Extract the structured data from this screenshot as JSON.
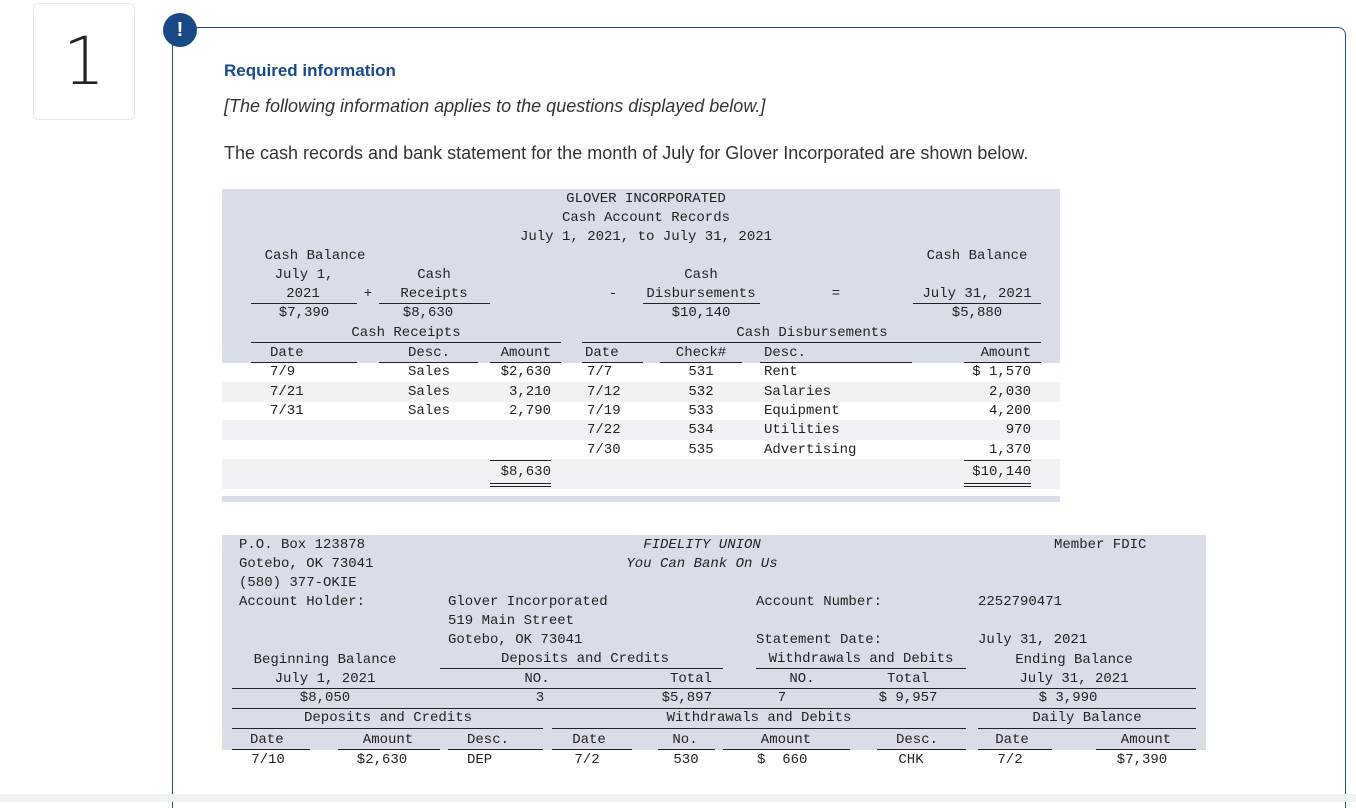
{
  "question": {
    "number": "1",
    "alert_icon": "!",
    "required": "Required information",
    "note": "[The following information applies to the questions displayed below.]",
    "intro": "The cash records and bank statement for the month of July for Glover Incorporated are shown below."
  },
  "cash_records": {
    "title": [
      "GLOVER INCORPORATED",
      "Cash Account Records",
      "July 1, 2021, to July 31, 2021"
    ],
    "summary": {
      "begin_label": [
        "Cash Balance",
        "July 1,",
        "2021"
      ],
      "begin_value": "$7,390",
      "plus": "+",
      "receipts_label": [
        "Cash",
        "Receipts"
      ],
      "receipts_value": "$8,630",
      "minus": "-",
      "disb_label": [
        "Cash",
        "Disbursements"
      ],
      "disb_value": "$10,140",
      "equals": "=",
      "end_label": [
        "Cash Balance",
        "July 31, 2021"
      ],
      "end_value": "$5,880"
    },
    "receipts": {
      "title": "Cash Receipts",
      "headers": [
        "Date",
        "Desc.",
        "Amount"
      ],
      "rows": [
        [
          "7/9",
          "Sales",
          "$2,630"
        ],
        [
          "7/21",
          "Sales",
          "3,210"
        ],
        [
          "7/31",
          "Sales",
          "2,790"
        ]
      ],
      "total": "$8,630"
    },
    "disbursements": {
      "title": "Cash Disbursements",
      "headers": [
        "Date",
        "Check#",
        "Desc.",
        "Amount"
      ],
      "rows": [
        [
          "7/7",
          "531",
          "Rent",
          "$ 1,570"
        ],
        [
          "7/12",
          "532",
          "Salaries",
          "2,030"
        ],
        [
          "7/19",
          "533",
          "Equipment",
          "4,200"
        ],
        [
          "7/22",
          "534",
          "Utilities",
          "970"
        ],
        [
          "7/30",
          "535",
          "Advertising",
          "1,370"
        ]
      ],
      "total": "$10,140"
    }
  },
  "bank": {
    "address": [
      "P.O. Box 123878",
      "Gotebo, OK 73041",
      "(580) 377-OKIE"
    ],
    "bank_name": "FIDELITY UNION",
    "slogan": "You Can Bank On Us",
    "member": "Member FDIC",
    "holder_label": "Account Holder:",
    "holder": [
      "Glover Incorporated",
      "519 Main Street",
      "Gotebo, OK 73041"
    ],
    "account_label": "Account Number:",
    "account_number": "2252790471",
    "statement_label": "Statement Date:",
    "statement_date": "July 31, 2021",
    "summary": {
      "begin_label": [
        "Beginning Balance",
        "July 1, 2021"
      ],
      "begin_value": "$8,050",
      "dep_label": "Deposits and Credits",
      "dep_no_label": "NO.",
      "dep_total_label": "Total",
      "dep_no": "3",
      "dep_total": "$5,897",
      "wd_label": "Withdrawals and Debits",
      "wd_no_label": "NO.",
      "wd_total_label": "Total",
      "wd_no": "7",
      "wd_total": "$ 9,957",
      "end_label": [
        "Ending Balance",
        "July 31, 2021"
      ],
      "end_value": "$ 3,990"
    },
    "detail": {
      "dep_title": "Deposits and Credits",
      "wd_title": "Withdrawals and Debits",
      "daily_title": "Daily Balance",
      "headers": [
        "Date",
        "Amount",
        "Desc.",
        "Date",
        "No.",
        "Amount",
        "Desc.",
        "Date",
        "Amount"
      ],
      "rows": [
        [
          "7/10",
          "$2,630",
          "DEP",
          "7/2",
          "530",
          "$  660",
          "CHK",
          "7/2",
          "$7,390"
        ]
      ]
    }
  }
}
